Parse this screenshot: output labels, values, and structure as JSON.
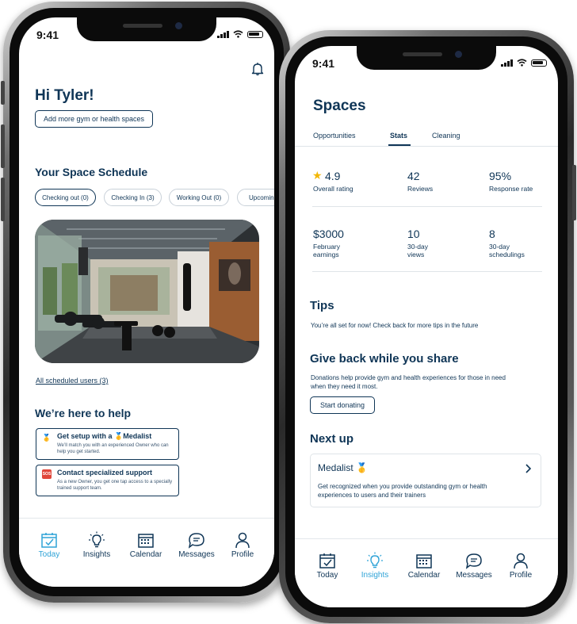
{
  "left_phone": {
    "status_bar": {
      "time": "9:41"
    },
    "greeting": "Hi Tyler!",
    "add_spaces_button": "Add more gym or health spaces",
    "schedule_title": "Your Space Schedule",
    "schedule_filters": [
      "Checking out (0)",
      "Checking In (3)",
      "Working Out (0)",
      "Upcoming"
    ],
    "all_scheduled_link": "All scheduled users (3)",
    "help_title": "We’re here to help",
    "help_cards": [
      {
        "icon": "medal-icon",
        "glyph": "🥇",
        "title": "Get setup with a 🥇Medalist",
        "desc": "We’ll match you with an experienced Owner who can help you get started."
      },
      {
        "icon": "sos-icon",
        "glyph": "SOS",
        "title": "Contact specialized support",
        "desc": "As a new Owner, you get one tap access to a specially trained support team."
      }
    ],
    "nav": [
      {
        "label": "Today",
        "icon": "calendar-check-icon"
      },
      {
        "label": "Insights",
        "icon": "lightbulb-icon"
      },
      {
        "label": "Calendar",
        "icon": "calendar-icon"
      },
      {
        "label": "Messages",
        "icon": "chat-icon"
      },
      {
        "label": "Profile",
        "icon": "person-icon"
      }
    ],
    "active_nav": "Today",
    "accent_color": "#2fa3d7",
    "text_color": "#0f3556"
  },
  "right_phone": {
    "status_bar": {
      "time": "9:41"
    },
    "title": "Spaces",
    "tabs": [
      "Opportunities",
      "Stats",
      "Cleaning"
    ],
    "active_tab": "Stats",
    "stats_row1": [
      {
        "value": "4.9",
        "label": "Overall rating",
        "icon": "star-icon"
      },
      {
        "value": "42",
        "label": "Reviews"
      },
      {
        "value": "95%",
        "label": "Response rate"
      }
    ],
    "stats_row2": [
      {
        "value": "$3000",
        "label": "February earnings"
      },
      {
        "value": "10",
        "label": "30-day views"
      },
      {
        "value": "8",
        "label": "30-day schedulings"
      }
    ],
    "tips_title": "Tips",
    "tips_text": "You’re all set for now! Check back for more tips in the future",
    "give_title": "Give back while you share",
    "give_text": "Donations help provide gym and health experiences for those in need when they need it most.",
    "donate_button": "Start donating",
    "next_title": "Next up",
    "next_card": {
      "title": "Medalist 🥇",
      "desc": "Get recognized when you provide outstanding gym or health experiences to users and their trainers"
    },
    "nav": [
      {
        "label": "Today",
        "icon": "calendar-check-icon"
      },
      {
        "label": "Insights",
        "icon": "lightbulb-icon"
      },
      {
        "label": "Calendar",
        "icon": "calendar-icon"
      },
      {
        "label": "Messages",
        "icon": "chat-icon"
      },
      {
        "label": "Profile",
        "icon": "person-icon"
      }
    ],
    "active_nav": "Insights"
  }
}
